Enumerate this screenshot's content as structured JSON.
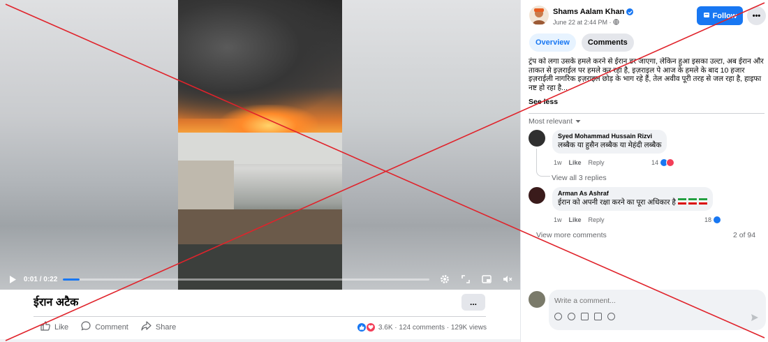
{
  "video": {
    "time": "0:01 / 0:22",
    "progress": 0.045
  },
  "post": {
    "title": "ईरान अटैक",
    "more_label": "...",
    "actions": {
      "like": "Like",
      "comment": "Comment",
      "share": "Share"
    },
    "stats": "3.6K · 124 comments · 129K views"
  },
  "author": {
    "name": "Shams Aalam Khan",
    "date": "June 22 at 2:44 PM ·",
    "follow_label": "Follow",
    "more_label": "•••"
  },
  "tabs": [
    {
      "label": "Overview"
    },
    {
      "label": "Comments"
    }
  ],
  "post_text": "ट्रंप को लगा उसके हमले करने से ईरान डर जाएगा, लेकिन हुआ इसका उल्टा, अब ईरान और ताकत से इज़राईल पर हमले कर रहा है, इज़राइल पे आज के हमले के बाद 10 हजार इज़राईली नागरिक इज़राइल छोड़ के भाग रहे हैं, तेल अवीव पूरी तरह से जल रहा है, हाइफा नष्ट हो रहा है...",
  "see_less": "See less",
  "sort_label": "Most relevant",
  "comments": [
    {
      "author": "Syed Mohammad Hussain Rizvi",
      "text": "लब्बैक या हुसैन लब्बैक या मेहंदी लब्बैक",
      "time": "1w",
      "like": "Like",
      "reply": "Reply",
      "reactions": "14"
    },
    {
      "author": "Arman As Ashraf",
      "text": "ईरान को अपनी रक्षा करने का पूरा अधिकार है",
      "time": "1w",
      "like": "Like",
      "reply": "Reply",
      "reactions": "18"
    }
  ],
  "view_replies": "View all 3 replies",
  "view_more": "View more comments",
  "count_of": "2 of 94",
  "composer": {
    "placeholder": "Write a comment..."
  },
  "colors": {
    "accent": "#1877f2",
    "overlay": "#e0232b"
  }
}
